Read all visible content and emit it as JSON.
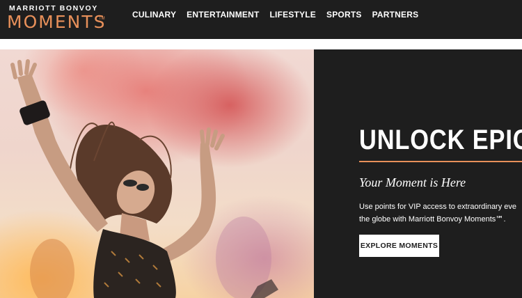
{
  "brand": {
    "top_line": "MARRIOTT BONVOY",
    "main": "MOMENTS",
    "trademark": "TM"
  },
  "nav": {
    "items": [
      {
        "label": "CULINARY"
      },
      {
        "label": "ENTERTAINMENT"
      },
      {
        "label": "LIFESTYLE"
      },
      {
        "label": "SPORTS"
      },
      {
        "label": "PARTNERS"
      }
    ]
  },
  "hero": {
    "headline": "UNLOCK EPIC",
    "subhead": "Your Moment is Here",
    "body_line_1": "Use points for VIP access to extraordinary eve",
    "body_line_2": "the globe with Marriott Bonvoy Moments℠.",
    "cta_label": "EXPLORE MOMENTS"
  },
  "colors": {
    "nav_background": "#1e1e1e",
    "accent": "#e8905a",
    "panel_background": "#1e1e1e",
    "button_background": "#ffffff"
  }
}
